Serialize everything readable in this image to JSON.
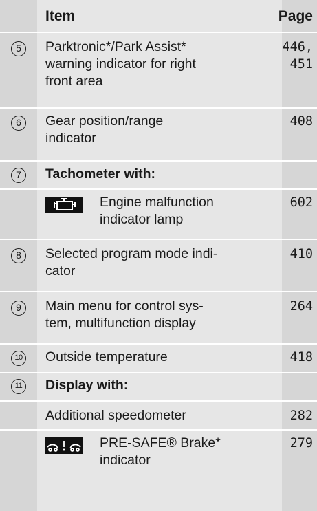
{
  "header": {
    "item": "Item",
    "page": "Page"
  },
  "rows": [
    {
      "num": "5",
      "text": [
        "Parktronic*/Park Assist*",
        "warning indicator for right",
        "front area"
      ],
      "page": [
        "446,",
        "451"
      ]
    },
    {
      "num": "6",
      "text": [
        "Gear position/range",
        "indicator"
      ],
      "page": [
        "408"
      ]
    },
    {
      "num": "7",
      "text": [
        "Tachometer with:"
      ],
      "page": []
    },
    {
      "icon": "engine-malfunction-icon",
      "text": [
        "Engine malfunction",
        "indicator lamp"
      ],
      "page": [
        "602"
      ]
    },
    {
      "num": "8",
      "text": [
        "Selected program mode indi-",
        "cator"
      ],
      "page": [
        "410"
      ]
    },
    {
      "num": "9",
      "text": [
        "Main menu for control sys-",
        "tem, multifunction display"
      ],
      "page": [
        "264"
      ]
    },
    {
      "num": "10",
      "text": [
        "Outside temperature"
      ],
      "page": [
        "418"
      ]
    },
    {
      "num": "11",
      "text": [
        "Display with:"
      ],
      "page": []
    },
    {
      "text": [
        "Additional speedometer"
      ],
      "page": [
        "282"
      ]
    },
    {
      "icon": "pre-safe-brake-icon",
      "text": [
        "PRE-SAFE® Brake*",
        "indicator"
      ],
      "page": [
        "279"
      ]
    }
  ]
}
